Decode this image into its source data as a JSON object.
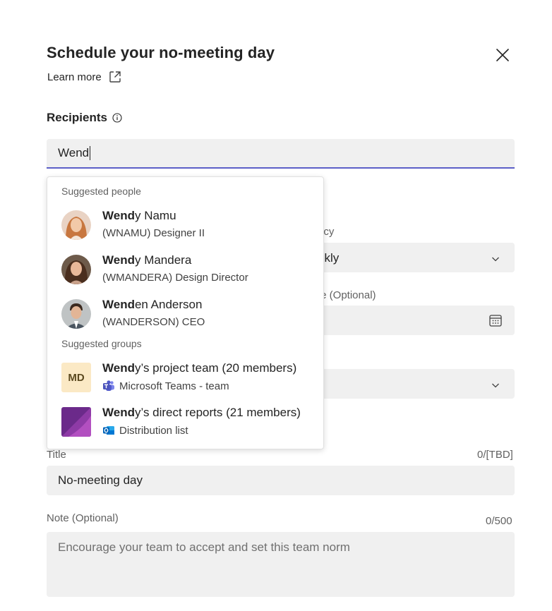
{
  "dialog": {
    "title": "Schedule your no-meeting day",
    "learn_more": "Learn more"
  },
  "recipients": {
    "label": "Recipients",
    "value": "Wend"
  },
  "frequency": {
    "label_partial": "ncy",
    "value_partial": "ekly"
  },
  "end_date": {
    "label_partial": "te (Optional)"
  },
  "title_field": {
    "label": "Title",
    "counter": "0/[TBD]",
    "value": "No-meeting day"
  },
  "note_field": {
    "label": "Note (Optional)",
    "counter": "0/500",
    "placeholder": "Encourage your team to accept and set this team norm"
  },
  "suggestions": {
    "people_header": "Suggested people",
    "people": [
      {
        "match": "Wend",
        "rest": "y Namu",
        "detail": "(WNAMU) Designer II"
      },
      {
        "match": "Wend",
        "rest": "y Mandera",
        "detail": "(WMANDERA) Design Director"
      },
      {
        "match": "Wend",
        "rest": "en Anderson",
        "detail": "(WANDERSON) CEO"
      }
    ],
    "groups_header": "Suggested groups",
    "groups": [
      {
        "match": "Wend",
        "rest": "y’s project team (20 members)",
        "detail": "Microsoft Teams - team",
        "initials": "MD",
        "icon": "teams-icon"
      },
      {
        "match": "Wend",
        "rest": "y’s direct reports (21 members)",
        "detail": "Distribution list",
        "icon": "outlook-icon"
      }
    ]
  },
  "colors": {
    "accent": "#5b5fc7",
    "field_bg": "#f0f0f0",
    "md_avatar_bg": "#fbe9c5"
  }
}
